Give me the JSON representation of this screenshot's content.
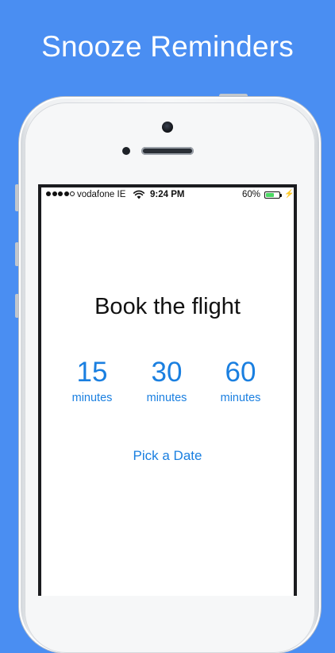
{
  "headline": "Snooze Reminders",
  "status_bar": {
    "signal_bars_filled": 4,
    "signal_bars_total": 5,
    "carrier": "vodafone IE",
    "wifi_icon": "wifi-icon",
    "time": "9:24 PM",
    "battery_percent": "60%",
    "battery_level": 0.6,
    "charging_icon": "bolt-icon"
  },
  "reminder": {
    "title": "Book the flight",
    "options": [
      {
        "value": "15",
        "unit": "minutes"
      },
      {
        "value": "30",
        "unit": "minutes"
      },
      {
        "value": "60",
        "unit": "minutes"
      }
    ],
    "pick_date_label": "Pick a Date"
  },
  "colors": {
    "background": "#4a8ef2",
    "accent": "#1a7fe0",
    "battery_fill": "#4cd964"
  }
}
